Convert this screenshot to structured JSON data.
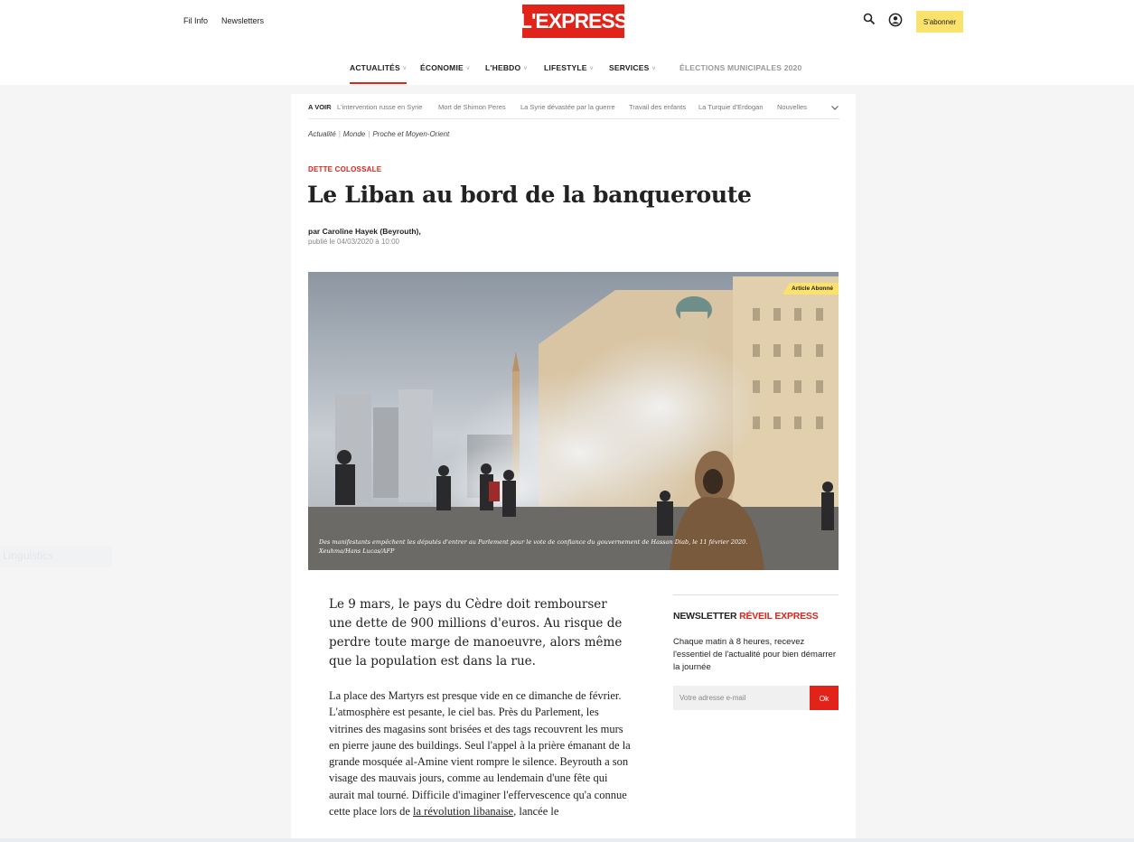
{
  "header": {
    "links": [
      "Fil Info",
      "Newsletters"
    ],
    "logo": "L'EXPRESS",
    "subscribe_label": "S'abonner",
    "icons": [
      "search-icon",
      "user-account-icon"
    ]
  },
  "nav": {
    "items": [
      {
        "label": "ACTUALITÉS",
        "chevron": "˅",
        "active": true
      },
      {
        "label": "ÉCONOMIE",
        "chevron": "˅"
      },
      {
        "label": "L'HEBDO",
        "chevron": "˅"
      },
      {
        "label": "LIFESTYLE",
        "chevron": "˅"
      },
      {
        "label": "SERVICES",
        "chevron": "˅"
      },
      {
        "label": "ÉLECTIONS MUNICIPALES 2020"
      }
    ]
  },
  "tags": {
    "label": "A VOIR",
    "items": [
      "L'intervention russe en Syrie",
      "Mort de Shimon Peres",
      "La Syrie dévastée par la guerre",
      "Travail des enfants",
      "La Turquie d'Erdogan",
      "Nouvelles"
    ]
  },
  "breadcrumb": [
    "Actualité",
    "Monde",
    "Proche et Moyen-Orient"
  ],
  "article": {
    "kicker": "DETTE COLOSSALE",
    "title": "Le Liban au bord de la banqueroute",
    "byline": "par Caroline Hayek (Beyrouth),",
    "published": "publié le 04/03/2020 à 10:00",
    "badge": "Article Abonné",
    "caption_line1": "Des manifestants empêchent les députés d'entrer au Parlement pour le vote de confiance du gouvernement de Hassan Diab, le 11 février 2020.",
    "caption_line2": "Xeuhma/Hans Lucas/AFP",
    "lead": "Le 9 mars, le pays du Cèdre doit rembourser une dette de 900 millions d'euros. Au risque de perdre toute marge de manoeuvre, alors même que la population est dans la rue.",
    "body_text": "La place des Martyrs est presque vide en ce dimanche de février. L'atmosphère est pesante, le ciel bas. Près du Parlement, les vitrines des magasins sont brisées et des tags recouvrent les murs en pierre jaune des buildings. Seul l'appel à la prière émanant de la grande mosquée al-Amine vient rompre le silence. Beyrouth a son visage des mauvais jours, comme au lendemain d'une fête qui aurait mal tourné. Difficile d'imaginer l'effervescence qu'a connue cette place lors de ",
    "body_link": "la révolution libanaise",
    "body_tail": ", lancée le"
  },
  "newsletter": {
    "title_prefix": "NEWSLETTER",
    "title_highlight": "RÉVEIL EXPRESS",
    "description": "Chaque matin à 8 heures, recevez l'essentiel de l'actualité pour bien démarrer la journée",
    "placeholder": "Votre adresse e-mail",
    "button": "Ok"
  },
  "side": {
    "ghost_text": "Linguistics"
  },
  "colors": {
    "brand_red": "#e2231a",
    "subscribe_yellow": "#fbe26d"
  }
}
